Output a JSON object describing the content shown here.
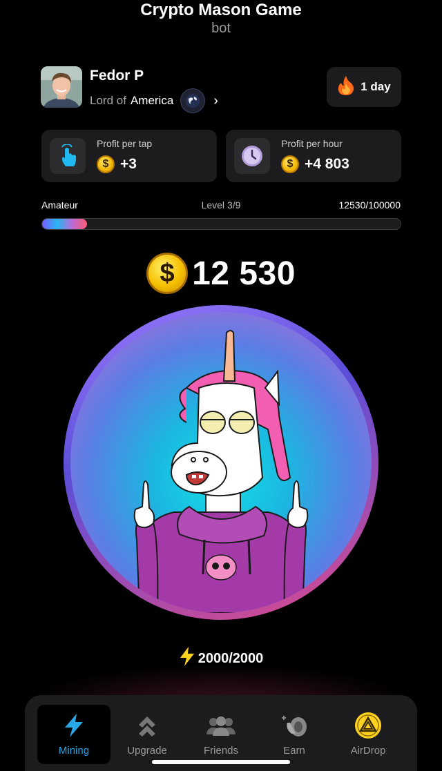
{
  "app": {
    "title": "Crypto Mason Game",
    "subtitle": "bot"
  },
  "user": {
    "name": "Fedor P",
    "title_prefix": "Lord of",
    "country": "America"
  },
  "streak": {
    "label": "1 day"
  },
  "stats": {
    "per_tap": {
      "label": "Profit per tap",
      "value": "+3"
    },
    "per_hour": {
      "label": "Profit per hour",
      "value": "+4 803"
    }
  },
  "level": {
    "rank": "Amateur",
    "level_text": "Level",
    "level_value": "3/9",
    "progress_text": "12530/100000",
    "progress_fraction": 0.1253
  },
  "balance": {
    "coin_symbol": "$",
    "amount": "12 530"
  },
  "energy": {
    "value": "2000/2000"
  },
  "nav": {
    "items": [
      {
        "label": "Mining",
        "icon": "lightning-icon",
        "active": true
      },
      {
        "label": "Upgrade",
        "icon": "double-chevron-up-icon",
        "active": false
      },
      {
        "label": "Friends",
        "icon": "friends-icon",
        "active": false
      },
      {
        "label": "Earn",
        "icon": "earn-icon",
        "active": false
      },
      {
        "label": "AirDrop",
        "icon": "airdrop-icon",
        "active": false
      }
    ]
  },
  "colors": {
    "accent": "#29a8e8",
    "card_bg": "#1c1c1e",
    "coin": "#f5c000"
  }
}
